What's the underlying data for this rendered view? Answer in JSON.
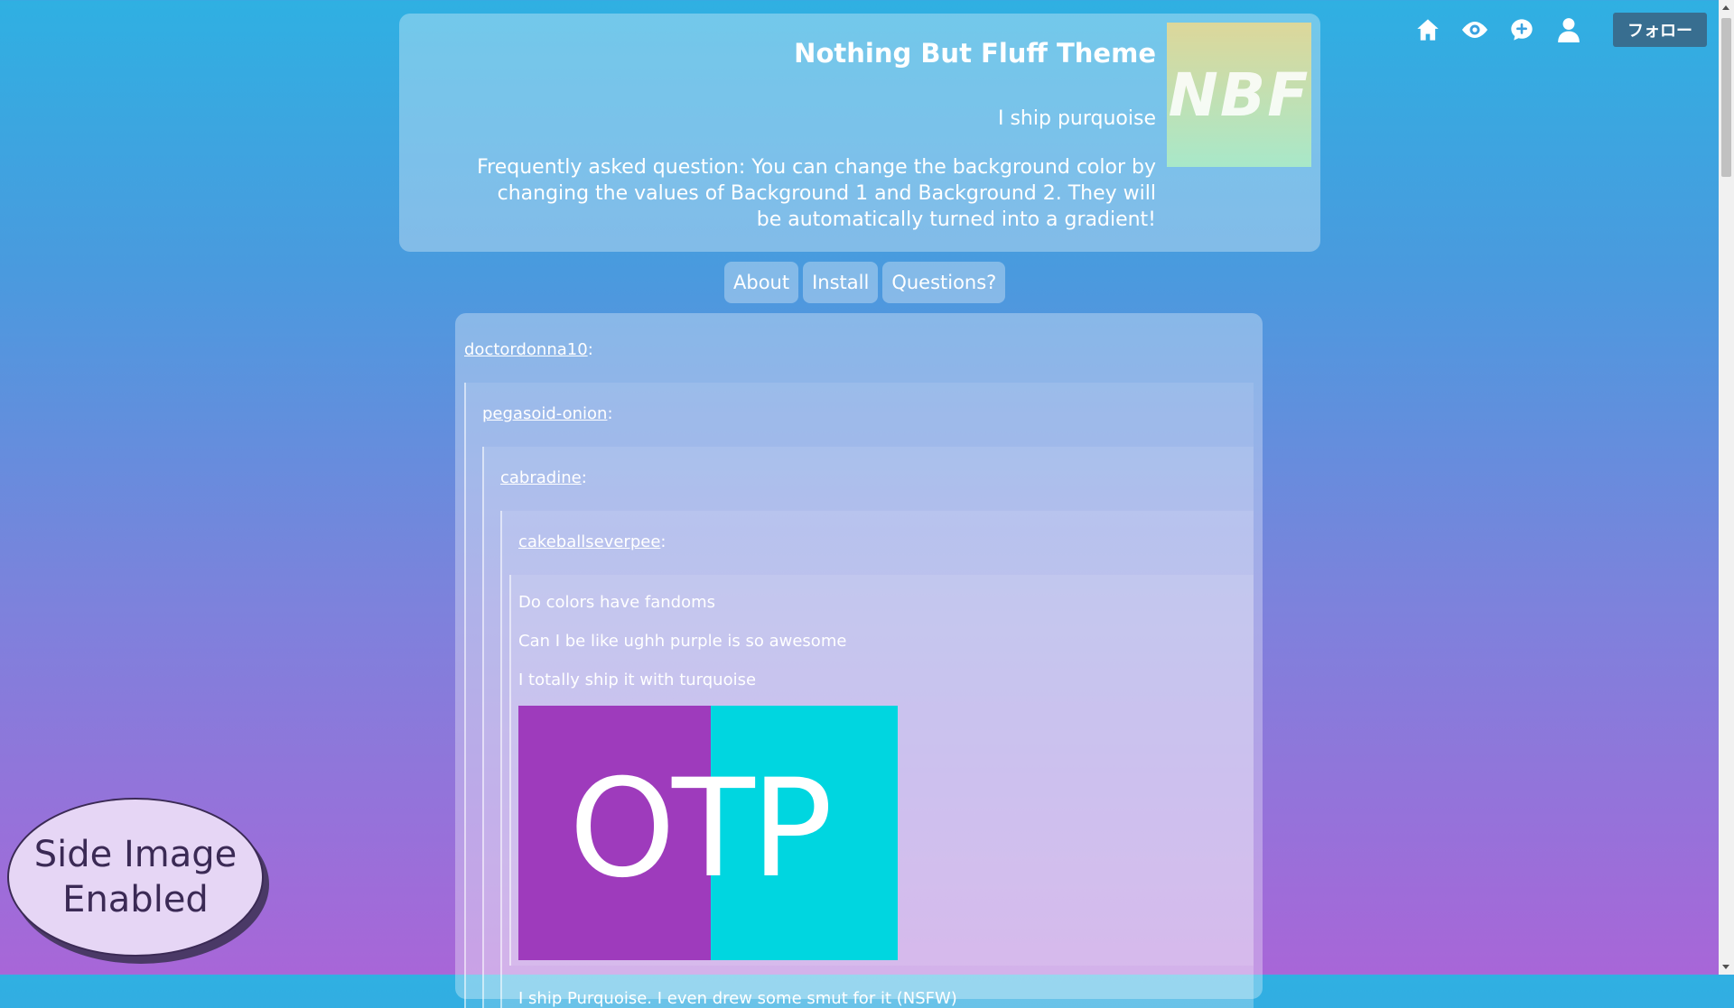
{
  "header": {
    "title": "Nothing But Fluff Theme",
    "subtitle": "I ship purquoise",
    "description": "Frequently asked question: You can change the background color by changing the values of Background 1 and Background 2. They will be automatically turned into a gradient!",
    "logo_text": "NBF"
  },
  "nav": {
    "about": "About",
    "install": "Install",
    "questions": "Questions?"
  },
  "topbar": {
    "follow_label": "フォロー",
    "icons": [
      "home-icon",
      "eye-icon",
      "chat-plus-icon",
      "user-icon"
    ]
  },
  "post": {
    "reblogs": [
      {
        "user": "doctordonna10",
        "sep": ":"
      },
      {
        "user": "pegasoid-onion",
        "sep": ":"
      },
      {
        "user": "cabradine",
        "sep": ":"
      },
      {
        "user": "cakeballseverpee",
        "sep": ":"
      }
    ],
    "original_lines": [
      "Do colors have fandoms",
      "Can I be like ughh purple is so awesome",
      "I totally ship it with turquoise"
    ],
    "image_text": "OTP",
    "next_line": "I ship Purquoise. I even drew some smut for it (NSFW)"
  },
  "side_badge": {
    "line1": "Side Image",
    "line2": "Enabled"
  },
  "colors": {
    "bg_top": "#2fb0e2",
    "bg_bottom": "#a866d8",
    "purple": "#9e3bbc",
    "turquoise": "#00d6e0",
    "follow_button": "#386e90"
  }
}
